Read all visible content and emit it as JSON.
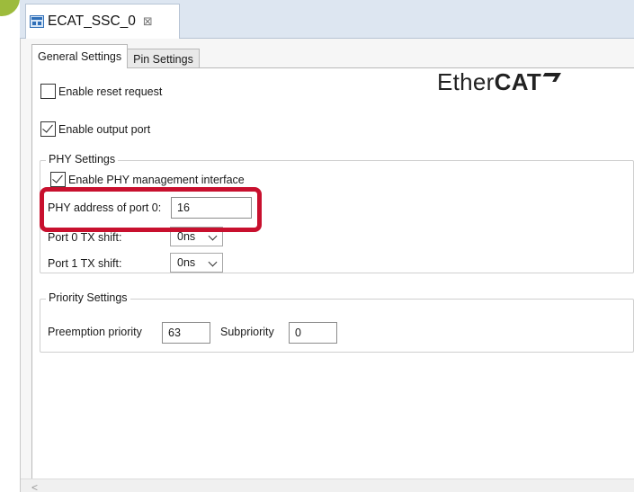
{
  "editor": {
    "title": "ECAT_SSC_0",
    "close_glyph": "⊠",
    "icon": "editor-window-icon"
  },
  "tabs": [
    {
      "label": "General Settings",
      "active": true
    },
    {
      "label": "Pin Settings",
      "active": false
    }
  ],
  "general": {
    "enable_reset_request": {
      "label": "Enable reset request",
      "checked": false
    },
    "enable_output_port": {
      "label": "Enable output port",
      "checked": true
    }
  },
  "logo": {
    "light": "Ether",
    "bold": "CAT"
  },
  "phy_settings": {
    "legend": "PHY Settings",
    "enable_phy_mgmt": {
      "label": "Enable PHY management interface",
      "checked": true
    },
    "phy_address": {
      "label": "PHY address of port 0:",
      "value": "16"
    },
    "port0_tx_shift": {
      "label": "Port 0 TX shift:",
      "value": "0ns"
    },
    "port1_tx_shift": {
      "label": "Port 1 TX shift:",
      "value": "0ns"
    }
  },
  "priority_settings": {
    "legend": "Priority Settings",
    "preemption": {
      "label": "Preemption priority",
      "value": "63"
    },
    "subpriority": {
      "label": "Subpriority",
      "value": "0"
    }
  },
  "scrollbar": {
    "left_arrow": "<"
  },
  "colors": {
    "highlight": "#c8102e",
    "tabbar": "#dde6f1",
    "accent_icon": "#2f6fb8"
  }
}
